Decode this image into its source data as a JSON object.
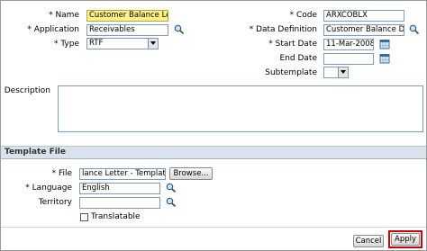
{
  "fields": {
    "name_label": "* Name",
    "name_value": "Customer Balance Letter",
    "application_label": "* Application",
    "application_value": "Receivables",
    "type_label": "* Type",
    "type_value": "RTF",
    "code_label": "* Code",
    "code_value": "ARXCOBLX",
    "data_definition_label": "* Data Definition",
    "data_definition_value": "Customer Balance Data c",
    "start_date_label": "* Start Date",
    "start_date_value": "11-Mar-2008",
    "end_date_label": "End Date",
    "end_date_value": "",
    "subtemplate_label": "Subtemplate",
    "subtemplate_value": "",
    "description_label": "Description",
    "description_value": ""
  },
  "template_file": {
    "section_title": "Template File",
    "file_label": "* File",
    "file_value": "lance Letter - Template.rtf",
    "browse_label": "Browse...",
    "language_label": "* Language",
    "language_value": "English",
    "territory_label": "Territory",
    "territory_value": "",
    "translatable_label": "Translatable",
    "translatable_checked": false
  },
  "actions": {
    "cancel_label": "Cancel",
    "apply_label": "Apply"
  },
  "icons": {
    "search": "search-icon",
    "calendar": "calendar-icon"
  },
  "colors": {
    "highlight": "#fff28a",
    "section_bar": "#d9e3ee",
    "apply_outline": "#cc0000"
  }
}
